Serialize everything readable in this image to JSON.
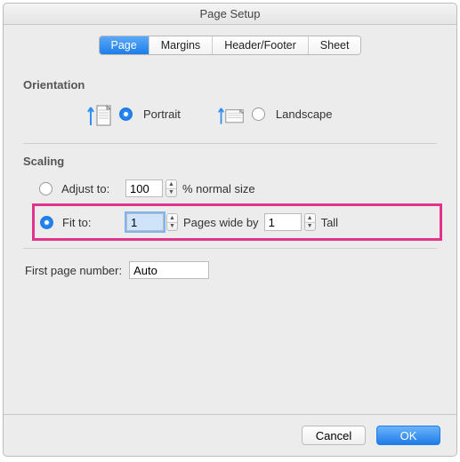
{
  "title": "Page Setup",
  "tabs": {
    "page": "Page",
    "margins": "Margins",
    "headerfooter": "Header/Footer",
    "sheet": "Sheet"
  },
  "orientation": {
    "heading": "Orientation",
    "portrait": "Portrait",
    "landscape": "Landscape"
  },
  "scaling": {
    "heading": "Scaling",
    "adjust_label": "Adjust to:",
    "adjust_value": "100",
    "normal_size": "% normal size",
    "fit_label": "Fit to:",
    "fit_wide": "1",
    "pages_wide_by": "Pages wide by",
    "fit_tall": "1",
    "tall": "Tall"
  },
  "first_page": {
    "label": "First page number:",
    "value": "Auto"
  },
  "footer": {
    "cancel": "Cancel",
    "ok": "OK"
  }
}
